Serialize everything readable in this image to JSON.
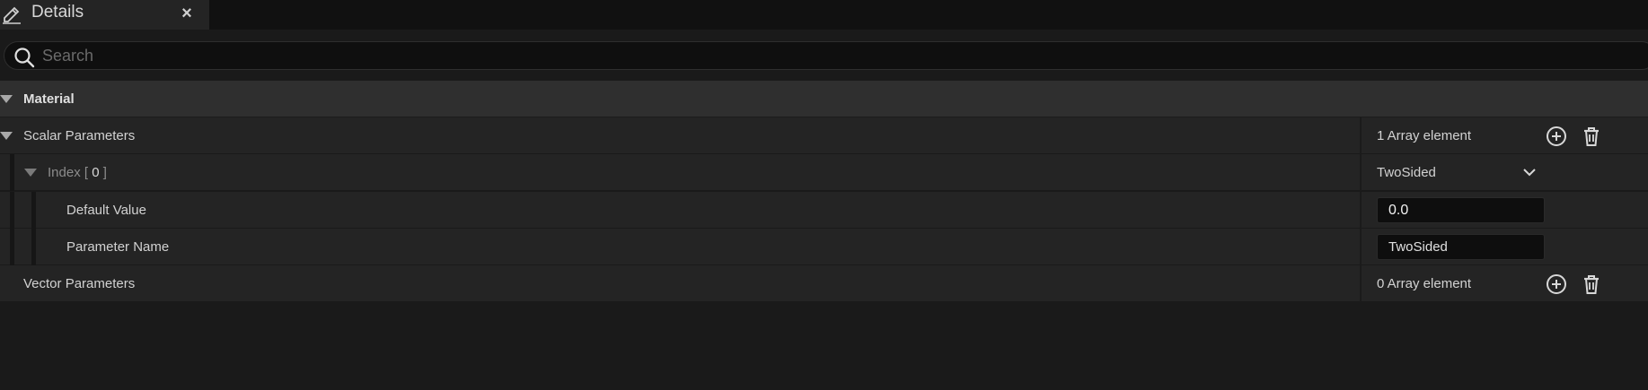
{
  "tab": {
    "title": "Details",
    "icon": "pencil-icon",
    "close": "×"
  },
  "search": {
    "placeholder": "Search",
    "value": ""
  },
  "category": {
    "label": "Material"
  },
  "scalar": {
    "label": "Scalar Parameters",
    "count": "1 Array element",
    "index": {
      "label_prefix": "Index [",
      "number": "0",
      "label_suffix": "]",
      "value": "TwoSided"
    },
    "default_value": {
      "label": "Default Value",
      "value": "0.0"
    },
    "parameter_name": {
      "label": "Parameter Name",
      "value": "TwoSided"
    }
  },
  "vector": {
    "label": "Vector Parameters",
    "count": "0 Array element"
  },
  "colors": {
    "background": "#1a1a1a",
    "row": "#242424",
    "category": "#2f2f2f",
    "text": "#d2d2d2"
  }
}
